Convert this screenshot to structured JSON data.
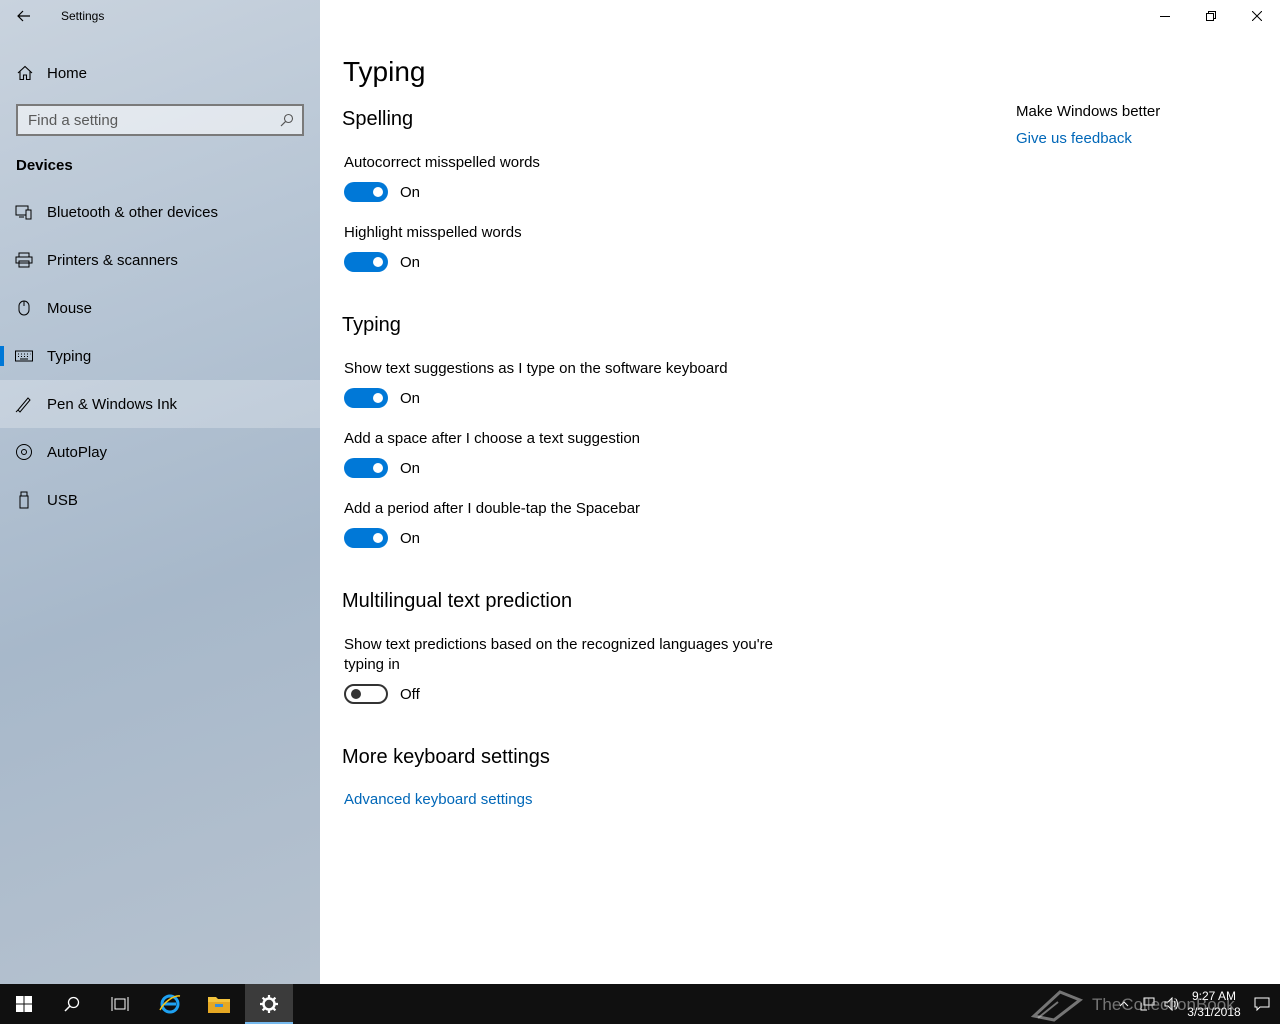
{
  "window": {
    "title": "Settings",
    "controls": {
      "minimize": "minimize-icon",
      "restore": "restore-icon",
      "close": "close-icon"
    }
  },
  "sidebar": {
    "home_label": "Home",
    "search_placeholder": "Find a setting",
    "section_label": "Devices",
    "selected_index": 3,
    "items": [
      {
        "label": "Bluetooth & other devices",
        "icon": "bluetooth-devices-icon"
      },
      {
        "label": "Printers & scanners",
        "icon": "printer-icon"
      },
      {
        "label": "Mouse",
        "icon": "mouse-icon"
      },
      {
        "label": "Typing",
        "icon": "keyboard-icon"
      },
      {
        "label": "Pen & Windows Ink",
        "icon": "pen-icon"
      },
      {
        "label": "AutoPlay",
        "icon": "autoplay-icon"
      },
      {
        "label": "USB",
        "icon": "usb-icon"
      }
    ]
  },
  "main": {
    "title": "Typing",
    "spelling": {
      "heading": "Spelling",
      "autocorrect": {
        "label": "Autocorrect misspelled words",
        "state": "On"
      },
      "highlight": {
        "label": "Highlight misspelled words",
        "state": "On"
      }
    },
    "typing": {
      "heading": "Typing",
      "suggestions": {
        "label": "Show text suggestions as I type on the software keyboard",
        "state": "On"
      },
      "space_after": {
        "label": "Add a space after I choose a text suggestion",
        "state": "On"
      },
      "period": {
        "label": "Add a period after I double-tap the Spacebar",
        "state": "On"
      }
    },
    "multilingual": {
      "heading": "Multilingual text prediction",
      "predictions": {
        "label": "Show text predictions based on the recognized languages you're typing in",
        "state": "Off"
      }
    },
    "more": {
      "heading": "More keyboard settings",
      "advanced_link": "Advanced keyboard settings"
    },
    "side": {
      "heading": "Make Windows better",
      "feedback_link": "Give us feedback"
    }
  },
  "taskbar": {
    "time": "9:27 AM",
    "date": "3/31/2018",
    "watermark": "TheCollectionBook"
  },
  "colors": {
    "accent": "#0078d7",
    "link": "#0067b8",
    "taskbar": "#101010"
  }
}
